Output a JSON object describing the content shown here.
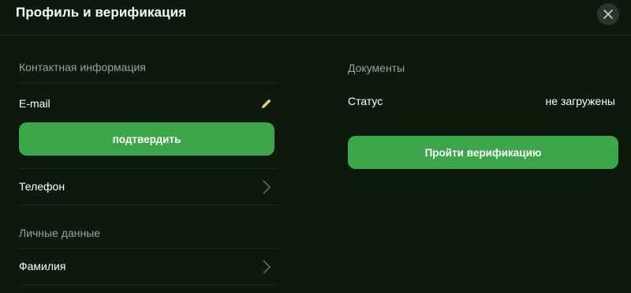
{
  "header": {
    "title": "Профиль и верификация"
  },
  "contact": {
    "section_label": "Контактная информация",
    "email_label": "E-mail",
    "confirm_label": "подтвердить",
    "phone_label": "Телефон"
  },
  "personal": {
    "section_label": "Личные данные",
    "surname_label": "Фамилия"
  },
  "documents": {
    "section_label": "Документы",
    "status_label": "Статус",
    "status_value": "не загружены",
    "verify_label": "Пройти верификацию"
  },
  "colors": {
    "background": "#0c190c",
    "accent_green": "#3ea64a",
    "pencil": "#e8c66a",
    "muted_text": "#9aa39a"
  },
  "icons": {
    "close": "close-icon",
    "edit": "pencil-icon",
    "chevron": "chevron-right-icon"
  }
}
